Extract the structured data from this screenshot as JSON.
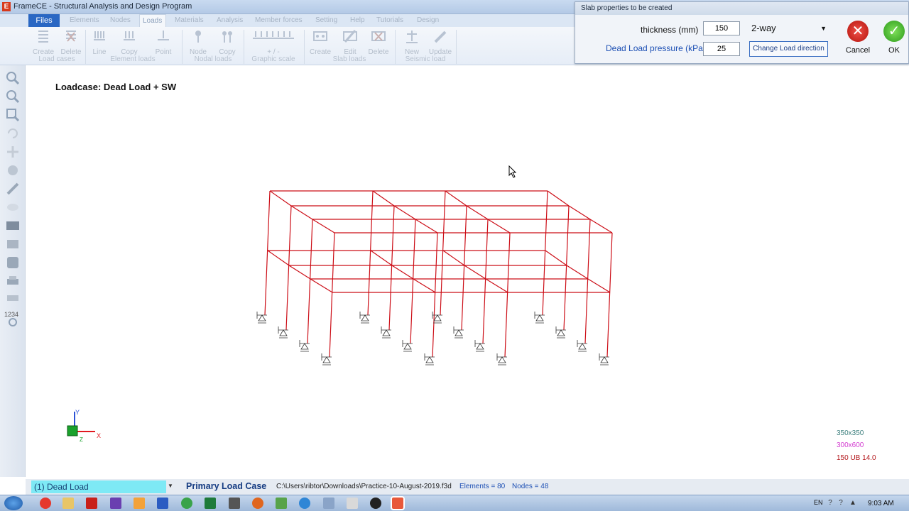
{
  "window": {
    "title": "FrameCE - Structural Analysis and Design Program"
  },
  "ribbon": {
    "tabs": [
      "Files",
      "Elements",
      "Nodes",
      "Loads",
      "Materials",
      "Analysis",
      "Member forces",
      "Setting",
      "Help",
      "Tutorials",
      "Design"
    ],
    "active_tab": "Loads",
    "buttons": {
      "create_lc": "Create",
      "delete_lc": "Delete",
      "line": "Line",
      "copy_el": "Copy",
      "point": "Point",
      "node": "Node",
      "copy_nl": "Copy",
      "scale": "+ / -",
      "create_slab": "Create",
      "edit_slab": "Edit",
      "delete_slab": "Delete",
      "new_seis": "New",
      "update_seis": "Update"
    },
    "groups": {
      "load_cases": "Load cases",
      "element_loads": "Element loads",
      "nodal_loads": "Nodal loads",
      "graphic_scale": "Graphic scale",
      "slab_loads": "Slab loads",
      "seismic_load": "Seismic load"
    }
  },
  "left_toolbar": {
    "numbers_label": "1234"
  },
  "dialog": {
    "title": "Slab properties to be created",
    "thickness_label": "thickness (mm)",
    "thickness_value": "150",
    "slab_type": "2-way",
    "dead_load_label": "Dead Load pressure (kPa)",
    "dead_load_value": "25",
    "change_direction_label": "Change Load direction",
    "cancel_label": "Cancel",
    "ok_label": "OK"
  },
  "canvas": {
    "loadcase_title": "Loadcase: Dead Load + SW",
    "axes": {
      "x": "X",
      "y": "Y",
      "z": "Z"
    },
    "sections": [
      {
        "name": "350x350",
        "color": "#3c7f7d"
      },
      {
        "name": "300x600",
        "color": "#d33bd0"
      },
      {
        "name": "150 UB 14.0",
        "color": "#b3171c"
      }
    ],
    "frame_color": "#cc0d16"
  },
  "statusbar": {
    "load_case": "(1) Dead Load",
    "primary": "Primary Load Case",
    "path": "C:\\Users\\ribtor\\Downloads\\Practice-10-August-2019.f3d",
    "elements": "Elements = 80",
    "nodes": "Nodes = 48"
  },
  "taskbar": {
    "language": "EN",
    "time": "9:03 AM"
  }
}
